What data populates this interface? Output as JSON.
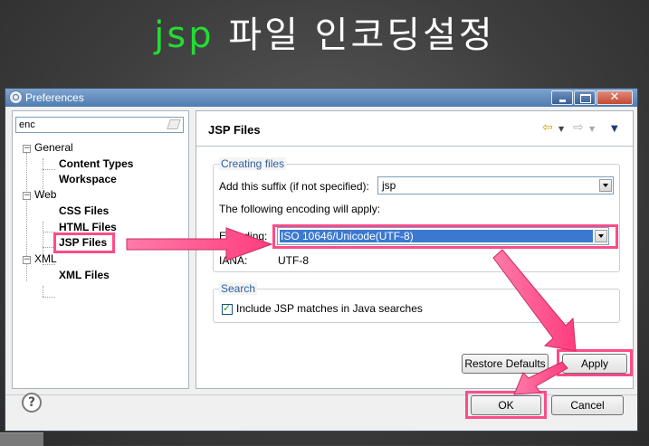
{
  "slide_title": {
    "part1": "jsp",
    "part2": "파일 인코딩설정"
  },
  "window": {
    "title": "Preferences"
  },
  "filter": {
    "value": "enc"
  },
  "tree": {
    "general": "General",
    "content_types": "Content Types",
    "workspace": "Workspace",
    "web": "Web",
    "css_files": "CSS Files",
    "html_files": "HTML Files",
    "jsp_files": "JSP Files",
    "xml": "XML",
    "xml_files": "XML Files"
  },
  "page": {
    "title": "JSP Files"
  },
  "creating": {
    "legend": "Creating files",
    "suffix_label": "Add this suffix (if not specified):",
    "suffix_value": "jsp",
    "encoding_note": "The following encoding will apply:",
    "encoding_label": "Encoding:",
    "encoding_value": "ISO 10646/Unicode(UTF-8)",
    "iana_label": "IANA:",
    "iana_value": "UTF-8"
  },
  "search": {
    "legend": "Search",
    "include_label": "Include JSP matches in Java searches",
    "include_checked": true
  },
  "buttons": {
    "restore": "Restore Defaults",
    "apply": "Apply",
    "ok": "OK",
    "cancel": "Cancel"
  },
  "colors": {
    "highlight": "#ff4b8a",
    "title_green": "#22dd33",
    "legend_blue": "#2d5fa0"
  }
}
